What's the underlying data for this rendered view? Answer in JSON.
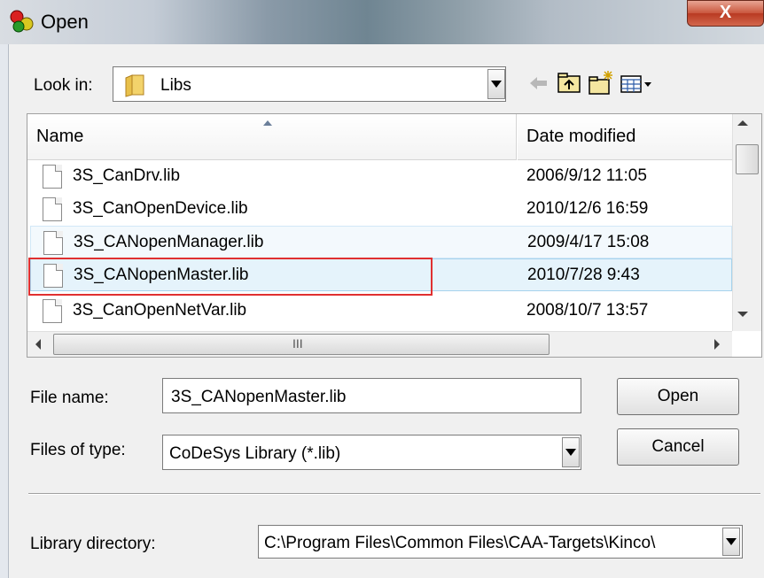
{
  "window": {
    "title": "Open",
    "close_glyph": "X"
  },
  "look_in": {
    "label": "Look in:",
    "value": "Libs"
  },
  "toolbar": {
    "icons": [
      "back-arrow-icon",
      "up-folder-icon",
      "new-folder-icon",
      "view-menu-icon"
    ]
  },
  "list": {
    "columns": {
      "name": "Name",
      "date": "Date modified"
    },
    "rows": [
      {
        "name": "3S_CanDrv.lib",
        "date": "2006/9/12 11:05"
      },
      {
        "name": "3S_CanOpenDevice.lib",
        "date": "2010/12/6 16:59"
      },
      {
        "name": "3S_CANopenManager.lib",
        "date": "2009/4/17 15:08"
      },
      {
        "name": "3S_CANopenMaster.lib",
        "date": "2010/7/28 9:43"
      },
      {
        "name": "3S_CanOpenNetVar.lib",
        "date": "2008/10/7 13:57"
      }
    ],
    "selected_index": 3,
    "hscroll_grip": "III"
  },
  "file_name": {
    "label": "File name:",
    "value": "3S_CANopenMaster.lib"
  },
  "files_of_type": {
    "label": "Files of type:",
    "value": "CoDeSys Library (*.lib)"
  },
  "buttons": {
    "open": "Open",
    "cancel": "Cancel"
  },
  "library_directory": {
    "label": "Library directory:",
    "value": "C:\\Program Files\\Common Files\\CAA-Targets\\Kinco\\"
  },
  "colors": {
    "selection": "#e5f3fb",
    "annotation_box": "#e03030",
    "close_button": "#c9563d"
  }
}
